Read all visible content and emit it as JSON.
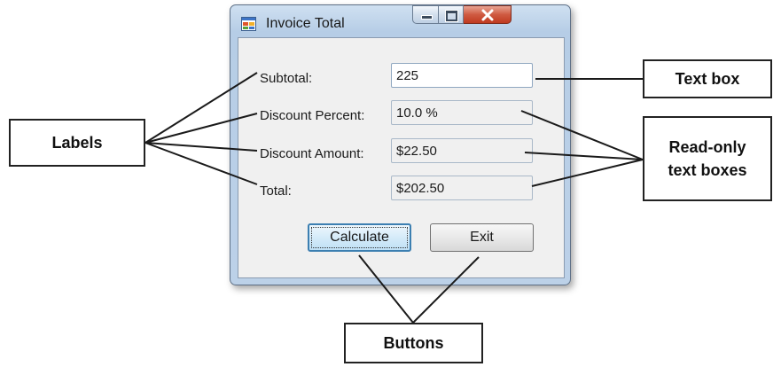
{
  "window": {
    "title": "Invoice Total",
    "caption_buttons": [
      "minimize",
      "maximize",
      "close"
    ]
  },
  "form": {
    "fields": [
      {
        "label": "Subtotal:",
        "value": "225",
        "readonly": false
      },
      {
        "label": "Discount Percent:",
        "value": "10.0 %",
        "readonly": true
      },
      {
        "label": "Discount Amount:",
        "value": "$22.50",
        "readonly": true
      },
      {
        "label": "Total:",
        "value": "$202.50",
        "readonly": true
      }
    ],
    "buttons": {
      "calculate": "Calculate",
      "exit": "Exit"
    }
  },
  "callouts": {
    "labels": "Labels",
    "text_box": "Text box",
    "read_only": "Read-only\ntext boxes",
    "buttons": "Buttons"
  },
  "colors": {
    "window_frame": "#bcd1e8",
    "client_bg": "#f0f0f0",
    "close_button": "#c03a20",
    "default_button_border": "#3c7fb1",
    "callout_border": "#222222"
  }
}
